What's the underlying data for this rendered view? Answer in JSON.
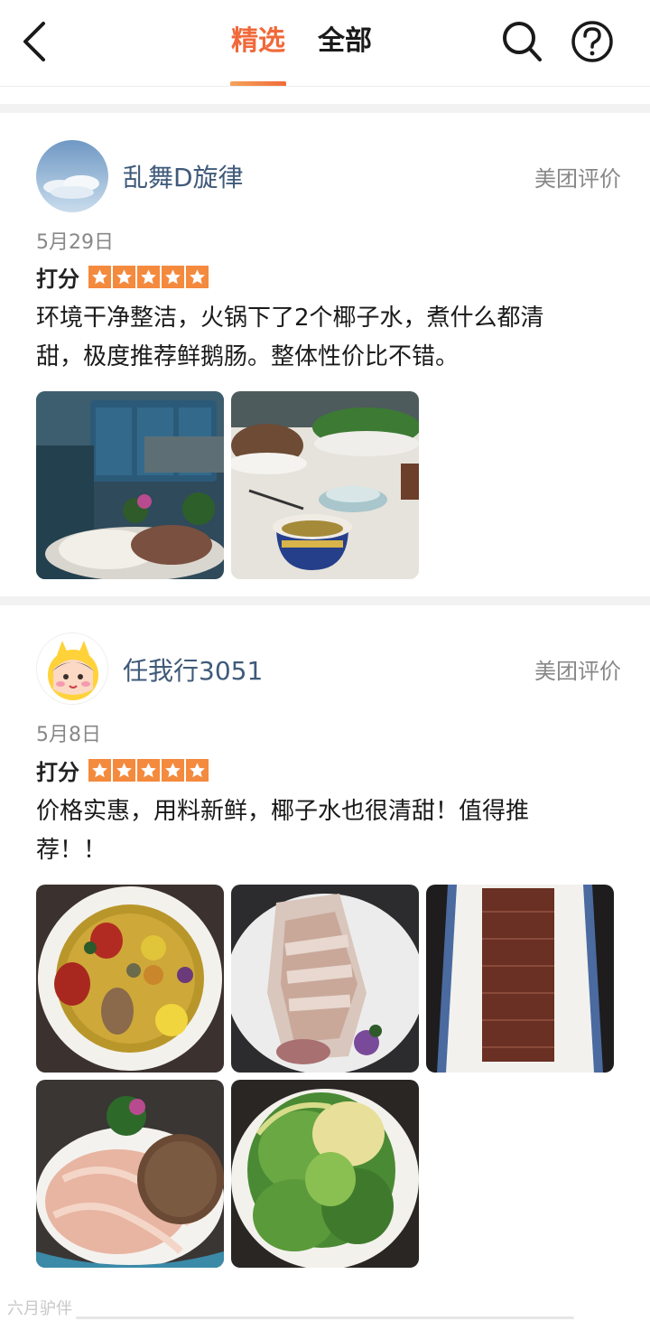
{
  "header": {
    "tabs": [
      {
        "label": "精选",
        "selected": true
      },
      {
        "label": "全部",
        "selected": false
      }
    ],
    "accent_color": "#f0693a"
  },
  "reviews": [
    {
      "username": "乱舞D旋律",
      "source": "美团评价",
      "date": "5月29日",
      "rating_label": "打分",
      "stars": 5,
      "text_lines": [
        "环境干净整洁，火锅下了2个椰子水，煮什么都清",
        "甜，极度推荐鲜鹅肠。整体性价比不错。"
      ],
      "photo_count": 2
    },
    {
      "username": "任我行3051",
      "source": "美团评价",
      "date": "5月8日",
      "rating_label": "打分",
      "stars": 5,
      "text_lines": [
        "价格实惠，用料新鲜，椰子水也很清甜！值得推",
        "荐！！"
      ],
      "photo_count": 5
    }
  ],
  "footer": {
    "watermark": "六月驴伴"
  },
  "icons": [
    "back-arrow-icon",
    "search-icon",
    "help-icon",
    "star-icon"
  ]
}
